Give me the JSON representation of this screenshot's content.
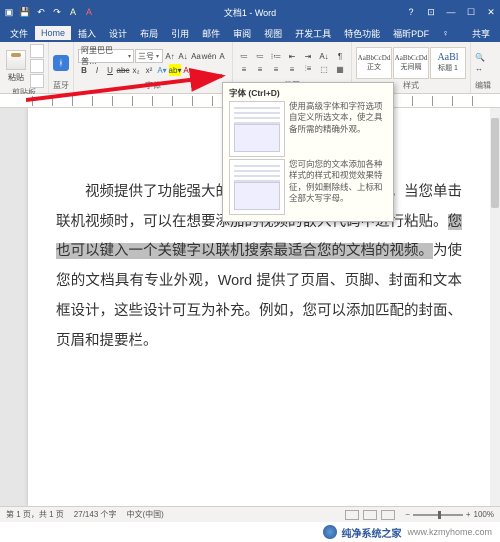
{
  "titlebar": {
    "title": "文档1 - Word",
    "qat_icons": [
      "word-icon",
      "save-icon",
      "undo-icon",
      "redo-icon",
      "touch-icon",
      "a-icon",
      "a-color-icon"
    ],
    "win": [
      "help",
      "ribbon-opts",
      "minimize",
      "maximize",
      "close"
    ]
  },
  "menu": {
    "file": "文件",
    "tabs": [
      "Home",
      "插入",
      "设计",
      "布局",
      "引用",
      "邮件",
      "审阅",
      "视图",
      "开发工具",
      "特色功能",
      "福昕PDF"
    ],
    "active": "Home",
    "tell": "♀",
    "share": "共享"
  },
  "ribbon": {
    "clipboard": {
      "paste": "粘贴",
      "cut": "剪切",
      "copy": "",
      "brush": "",
      "label": "剪贴板"
    },
    "bluetooth": {
      "label": "蓝牙"
    },
    "font": {
      "name": "阿里巴巴普…",
      "size": "三号",
      "label": "字体",
      "btns_row1": [
        "A↑",
        "A↓",
        "Aa",
        "Aˇ",
        "wén",
        "A"
      ],
      "btns_row2": [
        "B",
        "I",
        "U",
        "abc",
        "x₂",
        "x²",
        "A▾",
        "ab▾",
        "A▾"
      ]
    },
    "para": {
      "label": "段落",
      "row1": [
        "≔",
        "≔",
        "⁝≔",
        "≡",
        "☰",
        "⇤",
        "⇥",
        "A↓",
        "¶"
      ],
      "row2": [
        "≡",
        "≡",
        "≡",
        "≡",
        "⫶≡",
        "⬚",
        "▦"
      ]
    },
    "styles": {
      "label": "样式",
      "items": [
        {
          "prev": "AaBbCcDd",
          "name": "正文"
        },
        {
          "prev": "AaBbCcDd",
          "name": "无间隔"
        },
        {
          "prev": "AaBl",
          "name": "标题 1"
        }
      ]
    },
    "editing": {
      "find": "查找",
      "replace": "替换",
      "select": "编辑"
    }
  },
  "tooltip": {
    "title": "字体 (Ctrl+D)",
    "p1": "使用高级字体和字符选项自定义所选文本，使之具备所需的精确外观。",
    "p2": "您可向您的文本添加各种样式的样式和视觉效果特征，例如删除线、上标和全部大写字母。"
  },
  "document": {
    "t1": "视频提供了功能强大的方法帮助您证明您的观点。当您单击联机视频时，可以在想要添加的视频的嵌入代码中进行粘贴。",
    "hl": "您也可以键入一个关键字以联机搜索最适合您的文档的视频。",
    "t2": "为使您的文档具有专业外观，Word 提供了页眉、页脚、封面和文本框设计，这些设计可互为补充。例如，您可以添加匹配的封面、页眉和提要栏。"
  },
  "status": {
    "page": "第 1 页，共 1 页",
    "words": "27/143 个字",
    "lang": "中文(中国)",
    "zoom": "100%"
  },
  "watermark": {
    "brand": "纯净系统之家",
    "url": "www.kzmyhome.com"
  }
}
